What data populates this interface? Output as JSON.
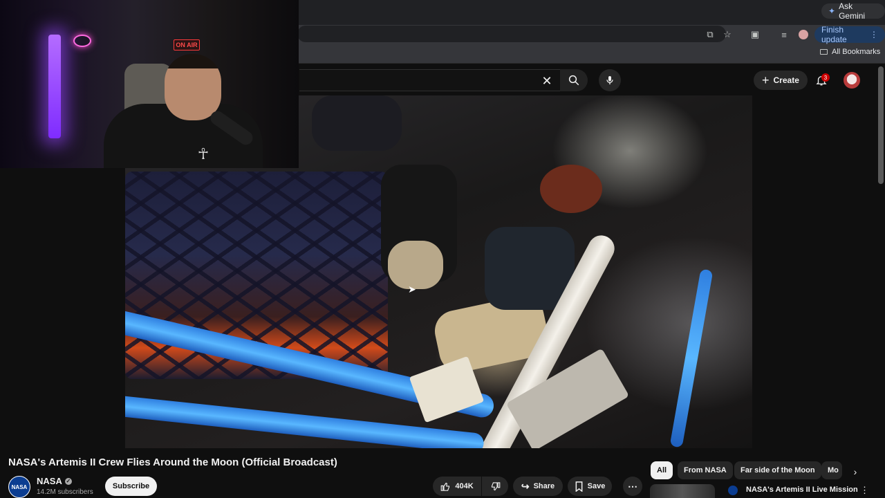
{
  "browser": {
    "ask_gemini_label": "Ask Gemini",
    "finish_update_label": "Finish update",
    "all_bookmarks_label": "All Bookmarks"
  },
  "header": {
    "create_label": "Create",
    "notification_count": "3"
  },
  "webcam": {
    "on_air_text": "ON AIR"
  },
  "video": {
    "title": "NASA's Artemis II Crew Flies Around the Moon (Official Broadcast)"
  },
  "channel": {
    "name": "NASA",
    "avatar_text": "NASA",
    "subscribers": "14.2M subscribers",
    "subscribe_label": "Subscribe"
  },
  "actions": {
    "like_count": "404K",
    "share_label": "Share",
    "save_label": "Save"
  },
  "chips": [
    "All",
    "From NASA",
    "Far side of the Moon",
    "Mo"
  ],
  "recommendation": {
    "title": "NASA's Artemis II Live Mission"
  },
  "colors": {
    "background": "#0f0f0f",
    "chip_active": "#f1f1f1",
    "pill": "#272727",
    "accent_update": "#a8c7fa",
    "notification_badge": "#cc0000"
  }
}
